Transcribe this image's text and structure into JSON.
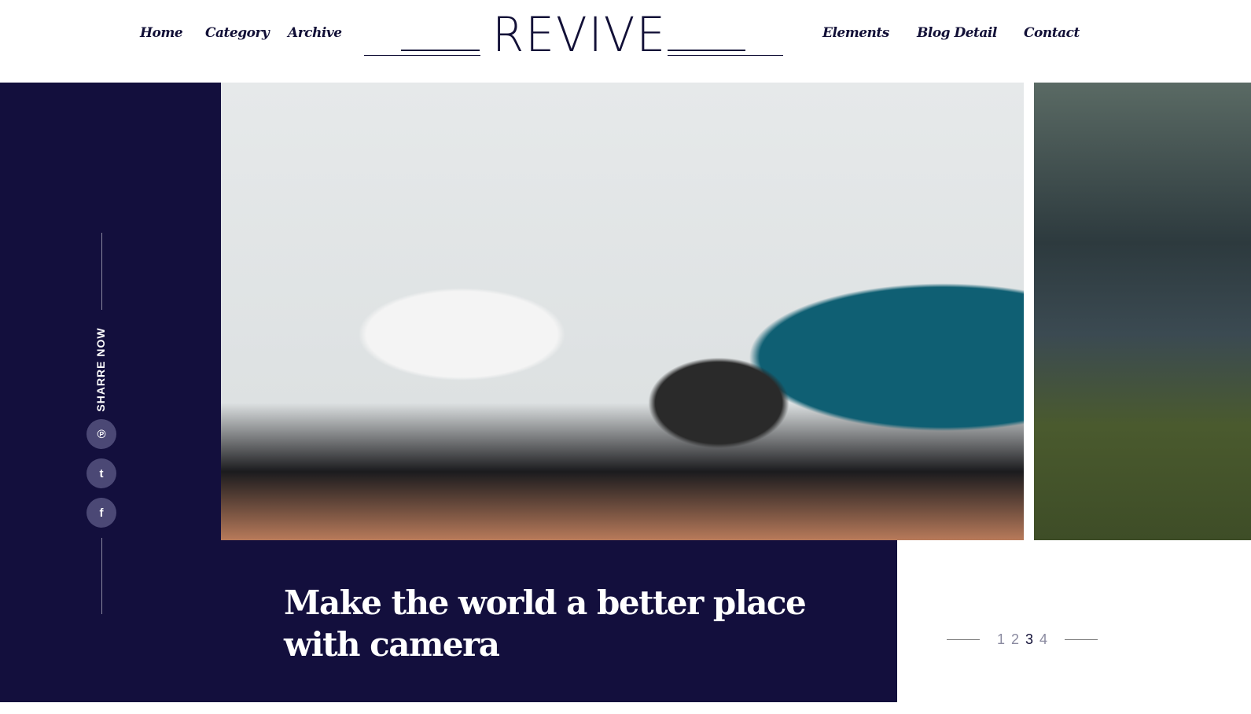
{
  "nav": {
    "left": [
      "Home",
      "Category",
      "Archive"
    ],
    "right": [
      "Elements",
      "Blog Detail",
      "Contact"
    ],
    "logo": "REVIVE"
  },
  "share": {
    "label": "SHARRE NOW",
    "icons": [
      "pinterest-icon",
      "twitter-icon",
      "facebook-icon"
    ]
  },
  "hero": {
    "title": "Make the world a better place with camera"
  },
  "pager": {
    "pages": [
      "1",
      "2",
      "3",
      "4"
    ],
    "current": "3"
  },
  "colors": {
    "navy": "#130f3d",
    "text": "#121037"
  }
}
